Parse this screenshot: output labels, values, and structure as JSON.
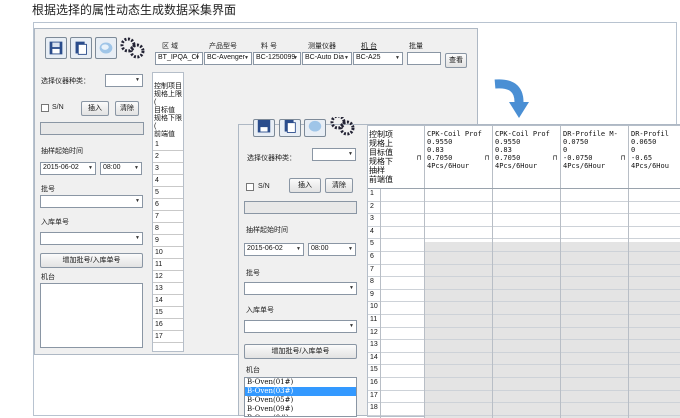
{
  "caption": "根据选择的属性动态生成数据采集界面",
  "back_window": {
    "top_labels": {
      "area": "区  域",
      "product_model": "产品型号",
      "material_no": "料  号",
      "instrument": "测量仪器",
      "machine": "机  台",
      "batch": "批量"
    },
    "top_values": {
      "area": "BT_IPQA_Cf",
      "product_model": "BC-Avenger",
      "material_no": "BC-1250099",
      "instrument": "BC-Auto Dia",
      "machine": "BC-A25"
    },
    "query_button": "查看",
    "instrument_type_label": "选择仪器种类：",
    "sn_label": "S/N",
    "insert_button": "插入",
    "clear_button": "清除",
    "sample_time_label": "抽样起始时间",
    "date_value": "2015-06-02",
    "time_value": "08:00",
    "batch_no_label": "批号",
    "stock_no_label": "入库单号",
    "add_batch_button": "增加批号/入库单号",
    "machine_label": "机台",
    "row_header_labels": [
      "控制项目",
      "规格上限(",
      "目标值",
      "规格下限(",
      "前端值"
    ],
    "row_numbers": [
      "1",
      "2",
      "3",
      "4",
      "5",
      "6",
      "7",
      "8",
      "9",
      "10",
      "11",
      "12",
      "13",
      "14",
      "15",
      "16",
      "17"
    ]
  },
  "front_window": {
    "instrument_type_label": "选择仪器种类：",
    "sn_label": "S/N",
    "insert_button": "插入",
    "clear_button": "清除",
    "sample_time_label": "抽样起始时间",
    "date_value": "2015-06-02",
    "time_value": "08:00",
    "batch_no_label": "批号",
    "stock_no_label": "入库单号",
    "add_batch_button": "增加批号/入库单号",
    "machine_label": "机台",
    "machine_list": [
      "B-Oven(01#)",
      "B-Oven(03#)",
      "B-Oven(05#)",
      "B-Oven(09#)",
      "B-Oven(0#)"
    ],
    "machine_selected_index": 1,
    "row_header_labels": [
      "控制项",
      "规格上",
      "目标值",
      "规格下",
      "抽样",
      "前端值"
    ],
    "columns": [
      {
        "name": "CPK-Coil Prof",
        "upper": "0.9550",
        "target": "0.83",
        "lower": "0.7050",
        "sampling": "4Pcs/6Hour"
      },
      {
        "name": "CPK-Coil Prof",
        "upper": "0.9550",
        "target": "0.83",
        "lower": "0.7050",
        "sampling": "4Pcs/6Hour"
      },
      {
        "name": "DR-Profile M-",
        "upper": "0.0750",
        "target": "0",
        "lower": "-0.0750",
        "sampling": "4Pcs/6Hour"
      },
      {
        "name": "DR-Profil",
        "upper": "0.0650",
        "target": "0",
        "lower": "-0.65",
        "sampling": "4Pcs/6Hou"
      }
    ],
    "row_numbers": [
      "1",
      "2",
      "3",
      "4",
      "5",
      "6",
      "7",
      "8",
      "9",
      "10",
      "11",
      "12",
      "13",
      "14",
      "15",
      "16",
      "17",
      "18"
    ]
  }
}
